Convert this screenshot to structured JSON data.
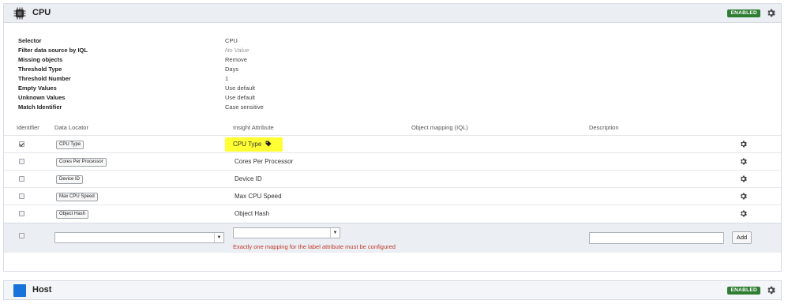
{
  "cpu_panel": {
    "title": "CPU",
    "status": "ENABLED",
    "icon": "cpu-chip-icon",
    "properties": [
      {
        "key": "Selector",
        "value": "CPU"
      },
      {
        "key": "Filter data source by IQL",
        "value": "No Value"
      },
      {
        "key": "Missing objects",
        "value": "Remove"
      },
      {
        "key": "Threshold Type",
        "value": "Days"
      },
      {
        "key": "Threshold Number",
        "value": "1"
      },
      {
        "key": "Empty Values",
        "value": "Use default"
      },
      {
        "key": "Unknown Values",
        "value": "Use default"
      },
      {
        "key": "Match Identifier",
        "value": "Case sensitive"
      }
    ],
    "columns": {
      "identifier": "Identifier",
      "data_locator": "Data Locator",
      "insight_attribute": "Insight Attribute",
      "object_mapping": "Object mapping (IQL)",
      "description": "Description"
    },
    "rows": [
      {
        "locator": "CPU Type",
        "attribute": "CPU Type",
        "identifier": true,
        "label_icon": "tag-icon"
      },
      {
        "locator": "Cores Per Processor",
        "attribute": "Cores Per Processor",
        "identifier": false
      },
      {
        "locator": "Device ID",
        "attribute": "Device ID",
        "identifier": false
      },
      {
        "locator": "Max CPU Speed",
        "attribute": "Max CPU Speed",
        "identifier": false
      },
      {
        "locator": "Object Hash",
        "attribute": "Object Hash",
        "identifier": false
      }
    ],
    "new_mapping": {
      "error": "Exactly one mapping for the label attribute must be configured",
      "add_label": "Add"
    },
    "colors": {
      "highlight": "#ffff33",
      "badge": "#2e7d32",
      "error": "#c0392b",
      "header_bg": "#ebeef3"
    }
  },
  "host_panel": {
    "title": "Host",
    "status": "ENABLED",
    "icon": "host-square-icon"
  }
}
